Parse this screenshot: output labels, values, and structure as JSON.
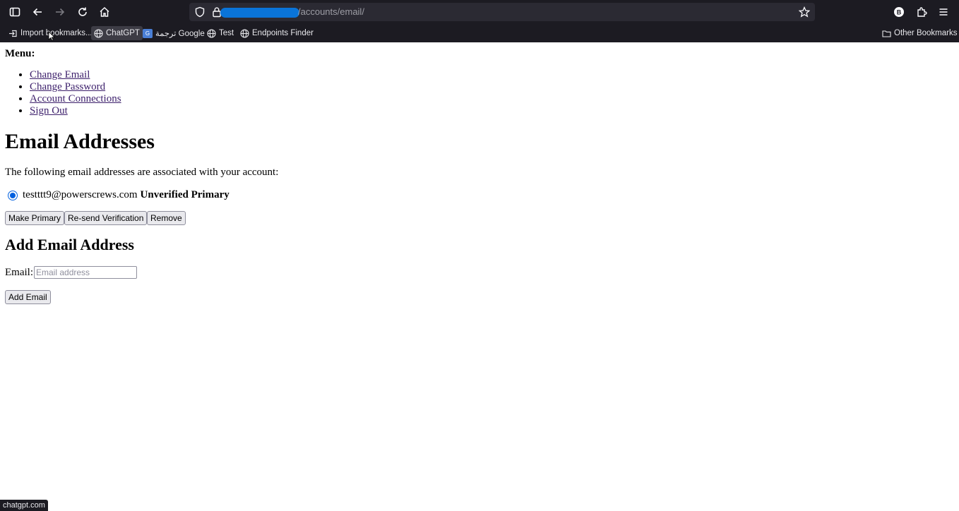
{
  "browser": {
    "url_path": "/accounts/email/",
    "bookmarks": [
      {
        "label": "Import bookmarks...",
        "icon": "import-icon"
      },
      {
        "label": "ChatGPT",
        "icon": "globe-icon"
      },
      {
        "label": "ترجمة Google",
        "icon": "google-translate-icon"
      },
      {
        "label": "Test",
        "icon": "globe-icon"
      },
      {
        "label": "Endpoints Finder",
        "icon": "globe-icon"
      }
    ],
    "other_bookmarks": "Other Bookmarks",
    "status_url": "chatgpt.com",
    "accent_color": "#0060df"
  },
  "page": {
    "menu_label": "Menu:",
    "menu": [
      "Change Email",
      "Change Password",
      "Account Connections",
      "Sign Out"
    ],
    "title": "Email Addresses",
    "assoc_text": "The following email addresses are associated with your account:",
    "email": {
      "address": "testttt9@powerscrews.com",
      "status": "Unverified Primary"
    },
    "buttons": {
      "make_primary": "Make Primary",
      "resend": "Re-send Verification",
      "remove": "Remove"
    },
    "add_title": "Add Email Address",
    "email_label": "Email:",
    "email_placeholder": "Email address",
    "add_button": "Add Email"
  }
}
